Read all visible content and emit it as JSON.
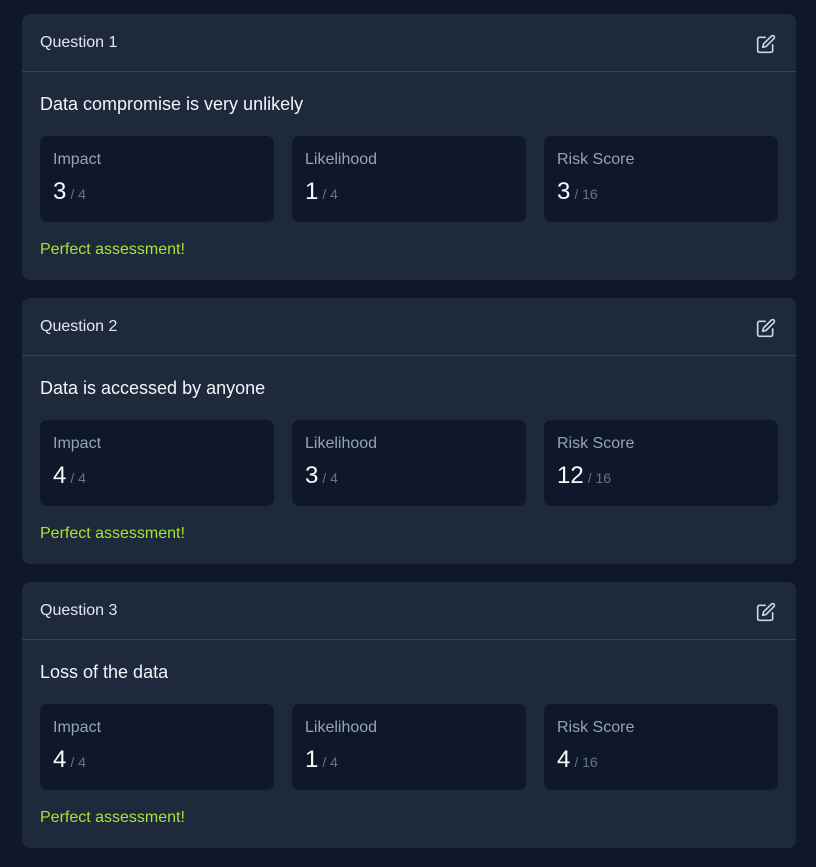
{
  "questions": [
    {
      "title": "Question 1",
      "statement": "Data compromise is very unlikely",
      "impact": {
        "label": "Impact",
        "value": "3",
        "max": "/ 4"
      },
      "likelihood": {
        "label": "Likelihood",
        "value": "1",
        "max": "/ 4"
      },
      "risk": {
        "label": "Risk Score",
        "value": "3",
        "max": "/ 16"
      },
      "feedback": "Perfect assessment!"
    },
    {
      "title": "Question 2",
      "statement": "Data is accessed by anyone",
      "impact": {
        "label": "Impact",
        "value": "4",
        "max": "/ 4"
      },
      "likelihood": {
        "label": "Likelihood",
        "value": "3",
        "max": "/ 4"
      },
      "risk": {
        "label": "Risk Score",
        "value": "12",
        "max": "/ 16"
      },
      "feedback": "Perfect assessment!"
    },
    {
      "title": "Question 3",
      "statement": "Loss of the data",
      "impact": {
        "label": "Impact",
        "value": "4",
        "max": "/ 4"
      },
      "likelihood": {
        "label": "Likelihood",
        "value": "1",
        "max": "/ 4"
      },
      "risk": {
        "label": "Risk Score",
        "value": "4",
        "max": "/ 16"
      },
      "feedback": "Perfect assessment!"
    }
  ],
  "icons": {
    "edit": "edit-icon"
  },
  "colors": {
    "background": "#0f172a",
    "card": "#1e293b",
    "metric_box": "#0f172a",
    "feedback": "#a3e635"
  }
}
